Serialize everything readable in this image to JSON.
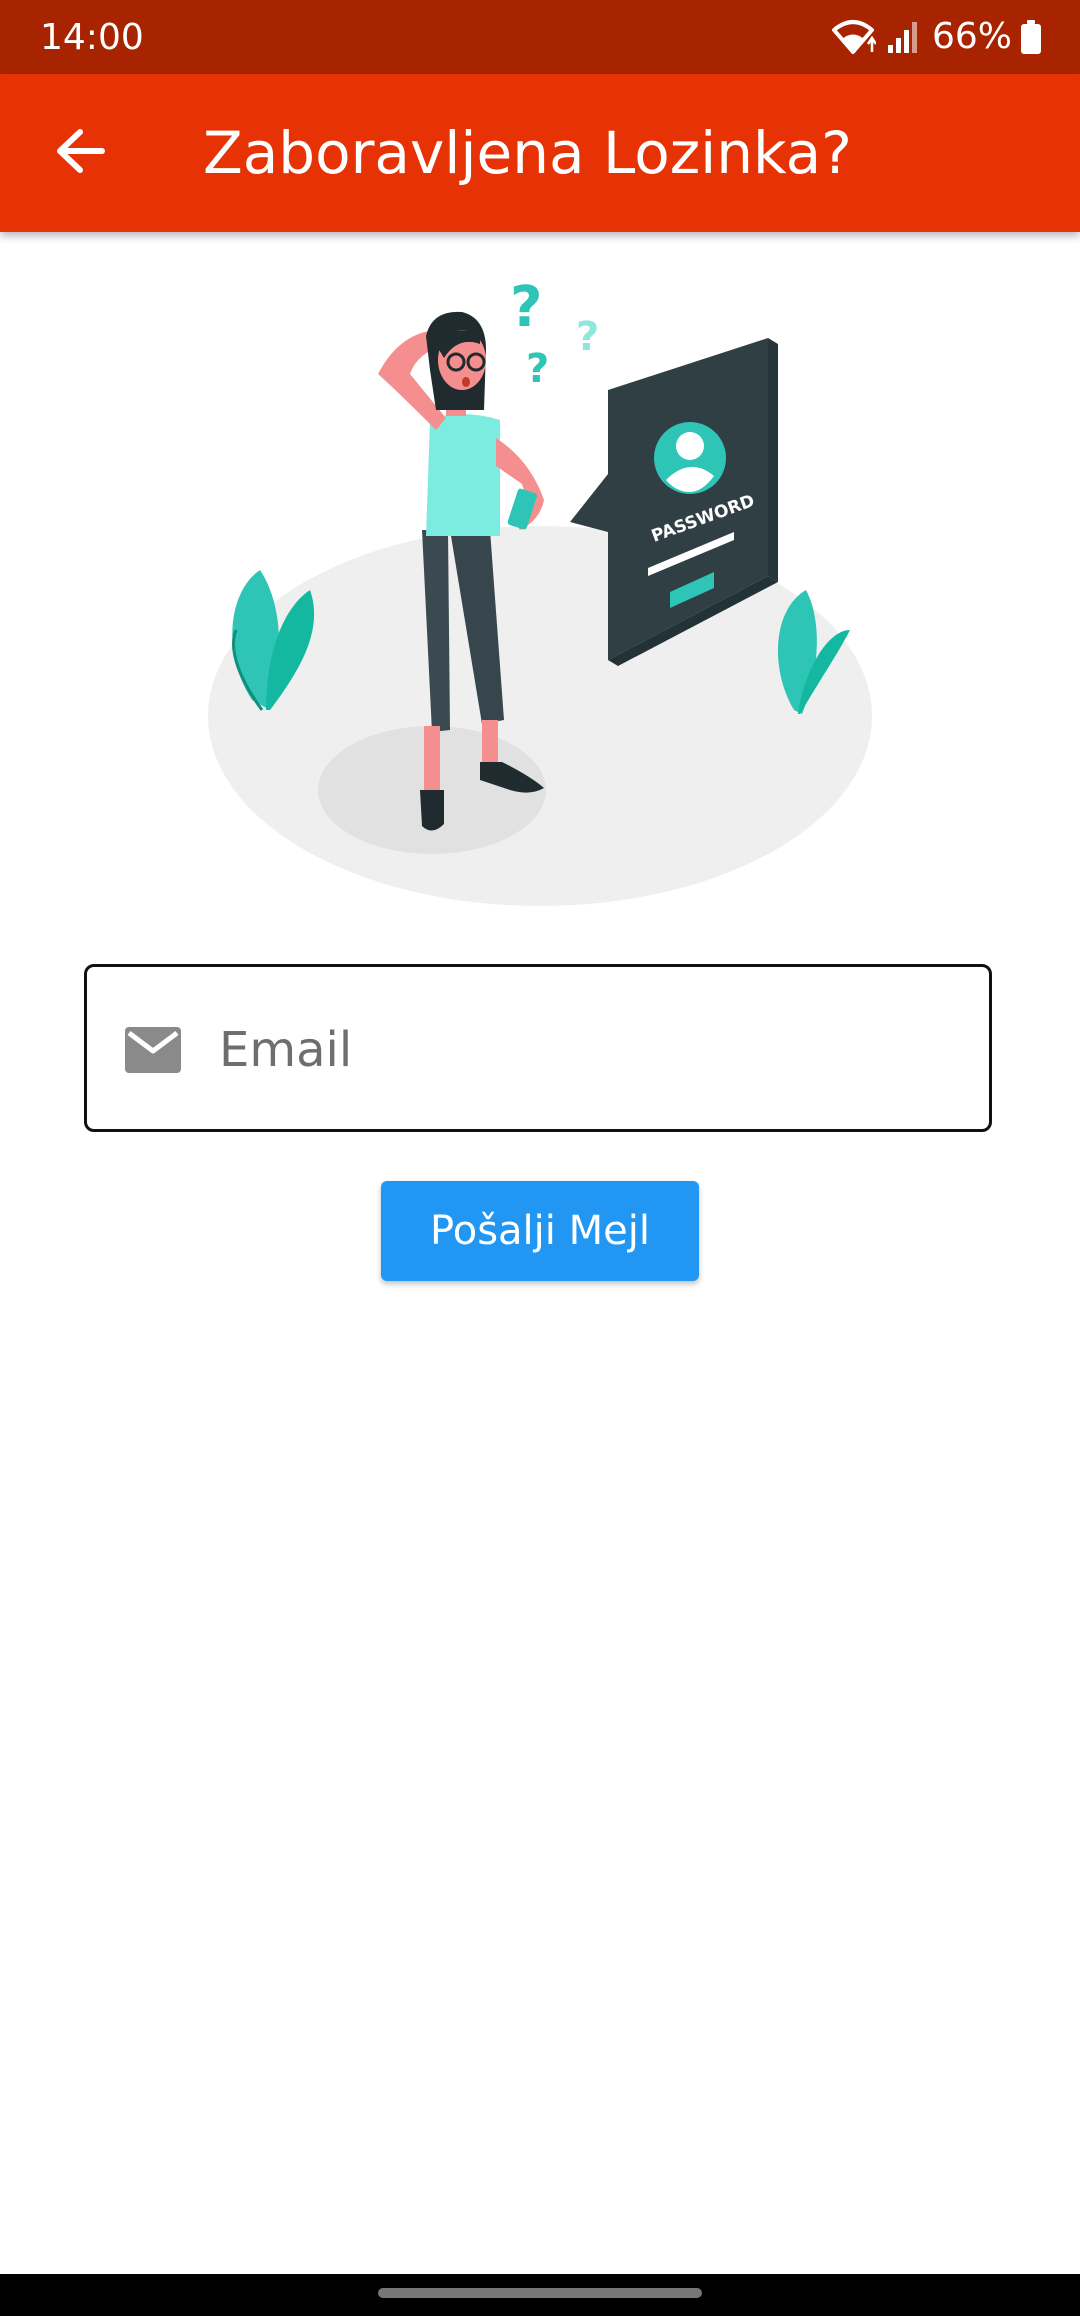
{
  "status_bar": {
    "time": "14:00",
    "battery_percent": "66%",
    "icons": [
      "wifi-icon",
      "signal-icon",
      "battery-icon"
    ]
  },
  "app_bar": {
    "title": "Zaboravljena Lozinka?",
    "back_icon": "arrow-left-icon",
    "color": "#e63204",
    "status_color": "#a82400"
  },
  "illustration": {
    "badge_text": "PASSWORD",
    "description_icon": "forgot-password-illustration"
  },
  "form": {
    "email_placeholder": "Email",
    "email_value": "",
    "email_icon": "mail-icon",
    "submit_label": "Pošalji Mejl",
    "submit_color": "#2196f3"
  }
}
